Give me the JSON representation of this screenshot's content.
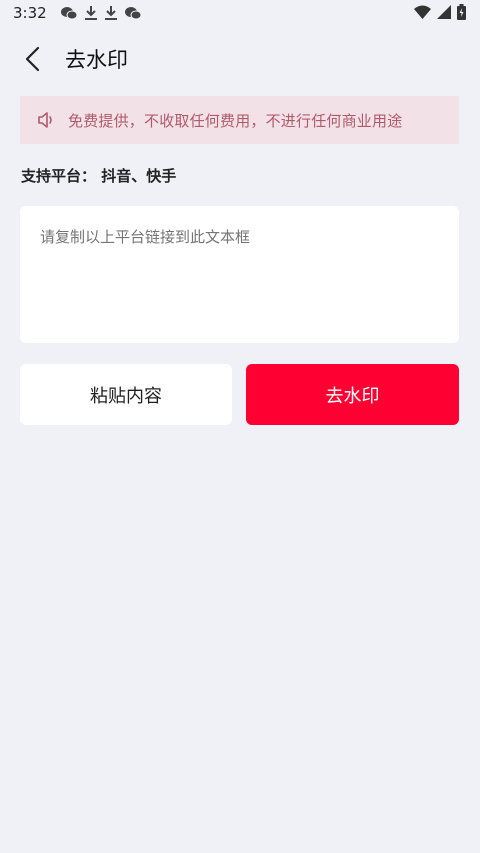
{
  "status_bar": {
    "time": "3:32",
    "left_icons": [
      "wechat-icon",
      "download-icon",
      "download-icon",
      "wechat-icon"
    ],
    "right_icons": [
      "wifi-icon",
      "signal-icon",
      "battery-icon"
    ]
  },
  "header": {
    "title": "去水印",
    "back_icon": "chevron-left-icon"
  },
  "notice": {
    "icon": "speaker-icon",
    "text": "免费提供，不收取任何费用，不进行任何商业用途",
    "background": "#f2e1e6",
    "text_color": "#b05a6e"
  },
  "platforms": {
    "text": "支持平台： 抖音、快手"
  },
  "input": {
    "placeholder": "请复制以上平台链接到此文本框",
    "value": ""
  },
  "buttons": {
    "paste_label": "粘贴内容",
    "remove_label": "去水印",
    "remove_color": "#ff0033"
  }
}
